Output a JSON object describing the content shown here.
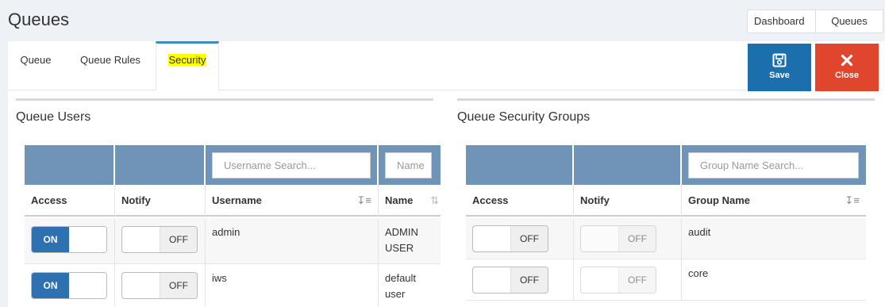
{
  "page": {
    "title": "Queues"
  },
  "breadcrumb": [
    {
      "label": "Dashboard"
    },
    {
      "label": "Queues"
    }
  ],
  "tabs": [
    {
      "label": "Queue"
    },
    {
      "label": "Queue Rules"
    },
    {
      "label": "Security"
    }
  ],
  "actions": {
    "save": {
      "label": "Save"
    },
    "close": {
      "label": "Close"
    }
  },
  "colors": {
    "accent": "#3c8dbc",
    "save": "#1c6fad",
    "close": "#e0462e",
    "filter_bar": "#6f94b8",
    "highlight": "#ffff00"
  },
  "users": {
    "title": "Queue Users",
    "search": {
      "username_placeholder": "Username Search...",
      "name_placeholder": "Name"
    },
    "columns": {
      "access": "Access",
      "notify": "Notify",
      "username": "Username",
      "name": "Name"
    },
    "rows": [
      {
        "access": "ON",
        "notify": "OFF",
        "username": "admin",
        "name_line1": "ADMIN",
        "name_line2": "USER"
      },
      {
        "access": "ON",
        "notify": "OFF",
        "username": "iws",
        "name_line1": "default",
        "name_line2": "user"
      }
    ]
  },
  "groups": {
    "title": "Queue Security Groups",
    "search": {
      "group_placeholder": "Group Name Search..."
    },
    "columns": {
      "access": "Access",
      "notify": "Notify",
      "group_name": "Group Name"
    },
    "rows": [
      {
        "access": "OFF",
        "notify": "OFF",
        "group_name": "audit"
      },
      {
        "access": "OFF",
        "notify": "OFF",
        "group_name": "core"
      }
    ]
  }
}
